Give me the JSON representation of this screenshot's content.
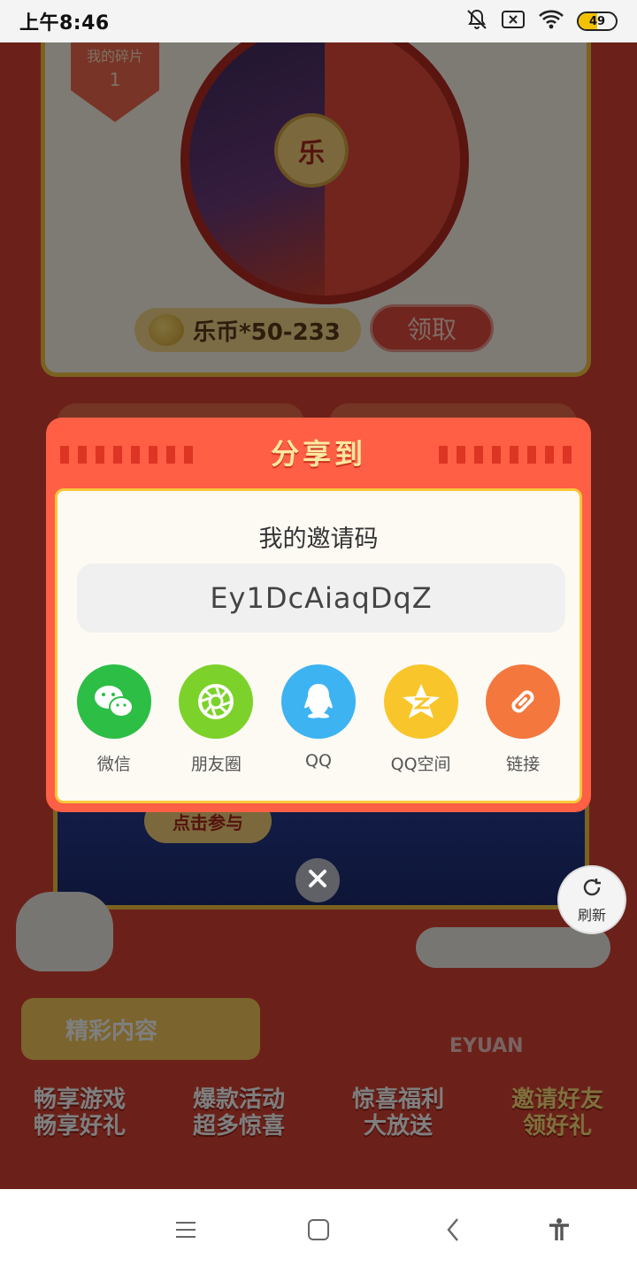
{
  "status_bar": {
    "time": "上午8:46",
    "battery": "49",
    "battery_level": 0.49,
    "icons": [
      "bell-off-icon",
      "sim-off-icon",
      "wifi-icon",
      "battery-icon"
    ]
  },
  "background": {
    "tag": {
      "title": "我的碎片",
      "count": "1"
    },
    "wheel_center": "乐",
    "reward_text": "乐币*50-233",
    "claim_label": "领取",
    "join_label": "点击参与",
    "section_title": "精彩内容",
    "brand": "EYUAN",
    "refresh_label": "刷新",
    "features": [
      {
        "line1": "畅享游戏",
        "line2": "畅享好礼"
      },
      {
        "line1": "爆款活动",
        "line2": "超多惊喜"
      },
      {
        "line1": "惊喜福利",
        "line2": "大放送"
      },
      {
        "line1": "邀请好友",
        "line2": "领好礼"
      }
    ]
  },
  "share_modal": {
    "title": "分享到",
    "invite_label": "我的邀请码",
    "invite_code": "Ey1DcAiaqDqZ",
    "targets": [
      {
        "label": "微信",
        "color": "#2dbe45",
        "icon": "wechat-icon"
      },
      {
        "label": "朋友圈",
        "color": "#7cd22a",
        "icon": "moments-icon"
      },
      {
        "label": "QQ",
        "color": "#3db3f2",
        "icon": "qq-icon"
      },
      {
        "label": "QQ空间",
        "color": "#f8c62a",
        "icon": "qzone-icon"
      },
      {
        "label": "链接",
        "color": "#f4773d",
        "icon": "link-icon"
      }
    ]
  },
  "nav_bar": {
    "icons": [
      "menu-icon",
      "home-icon",
      "back-icon",
      "accessibility-icon"
    ]
  }
}
